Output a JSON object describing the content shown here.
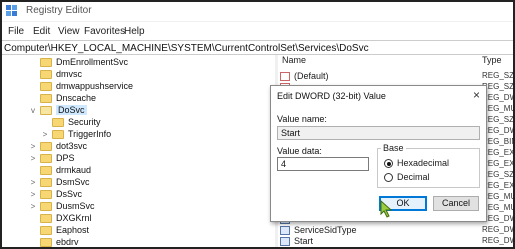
{
  "window": {
    "title": "Registry Editor"
  },
  "menu": [
    "File",
    "Edit",
    "View",
    "Favorites",
    "Help"
  ],
  "address": "Computer\\HKEY_LOCAL_MACHINE\\SYSTEM\\CurrentControlSet\\Services\\DoSvc",
  "tree": {
    "items": [
      {
        "label": "DmEnrollmentSvc",
        "selected": false,
        "expander": ""
      },
      {
        "label": "dmvsc",
        "selected": false,
        "expander": ""
      },
      {
        "label": "dmwappushservice",
        "selected": false,
        "expander": ""
      },
      {
        "label": "Dnscache",
        "selected": false,
        "expander": ""
      },
      {
        "label": "DoSvc",
        "selected": true,
        "expander": "v"
      },
      {
        "label": "Security",
        "selected": false,
        "expander": ""
      },
      {
        "label": "TriggerInfo",
        "selected": false,
        "expander": ">"
      },
      {
        "label": "dot3svc",
        "selected": false,
        "expander": ">"
      },
      {
        "label": "DPS",
        "selected": false,
        "expander": ">"
      },
      {
        "label": "drmkaud",
        "selected": false,
        "expander": ""
      },
      {
        "label": "DsmSvc",
        "selected": false,
        "expander": ">"
      },
      {
        "label": "DsSvc",
        "selected": false,
        "expander": ">"
      },
      {
        "label": "DusmSvc",
        "selected": false,
        "expander": ">"
      },
      {
        "label": "DXGKrnl",
        "selected": false,
        "expander": ""
      },
      {
        "label": "Eaphost",
        "selected": false,
        "expander": ""
      },
      {
        "label": "ebdrv",
        "selected": false,
        "expander": ""
      }
    ]
  },
  "list": {
    "headers": {
      "name": "Name",
      "type": "Type"
    },
    "rows": [
      {
        "name": "(Default)",
        "type": "REG_SZ",
        "icon": "string-value-icon"
      },
      {
        "name": "",
        "type": "REG_SZ",
        "icon": "string-value-icon"
      },
      {
        "name": "",
        "type": "REG_DW",
        "icon": "binary-value-icon"
      },
      {
        "name": "",
        "type": "REG_MU",
        "icon": "string-value-icon"
      },
      {
        "name": "",
        "type": "REG_SZ",
        "icon": "string-value-icon"
      },
      {
        "name": "",
        "type": "REG_DW",
        "icon": "binary-value-icon"
      },
      {
        "name": "",
        "type": "REG_BIN",
        "icon": "binary-value-icon"
      },
      {
        "name": "",
        "type": "REG_EXP",
        "icon": "string-value-icon"
      },
      {
        "name": "",
        "type": "REG_EXP",
        "icon": "string-value-icon"
      },
      {
        "name": "",
        "type": "REG_SZ",
        "icon": "string-value-icon"
      },
      {
        "name": "",
        "type": "REG_EXP",
        "icon": "string-value-icon"
      },
      {
        "name": "",
        "type": "REG_MU",
        "icon": "string-value-icon"
      },
      {
        "name": "",
        "type": "REG_MU",
        "icon": "string-value-icon"
      },
      {
        "name": "",
        "type": "REG_DW",
        "icon": "binary-value-icon"
      },
      {
        "name": "ServiceSidType",
        "type": "REG_DW",
        "icon": "binary-value-icon"
      },
      {
        "name": "Start",
        "type": "REG_DW",
        "icon": "binary-value-icon"
      }
    ]
  },
  "dialog": {
    "title": "Edit DWORD (32-bit) Value",
    "close_glyph": "×",
    "value_name_label": "Value name:",
    "value_name": "Start",
    "value_data_label": "Value data:",
    "value_data": "4",
    "base_label": "Base",
    "radio_hex": "Hexadecimal",
    "radio_dec": "Decimal",
    "base_selected": "Hexadecimal",
    "ok_label": "OK",
    "cancel_label": "Cancel"
  }
}
